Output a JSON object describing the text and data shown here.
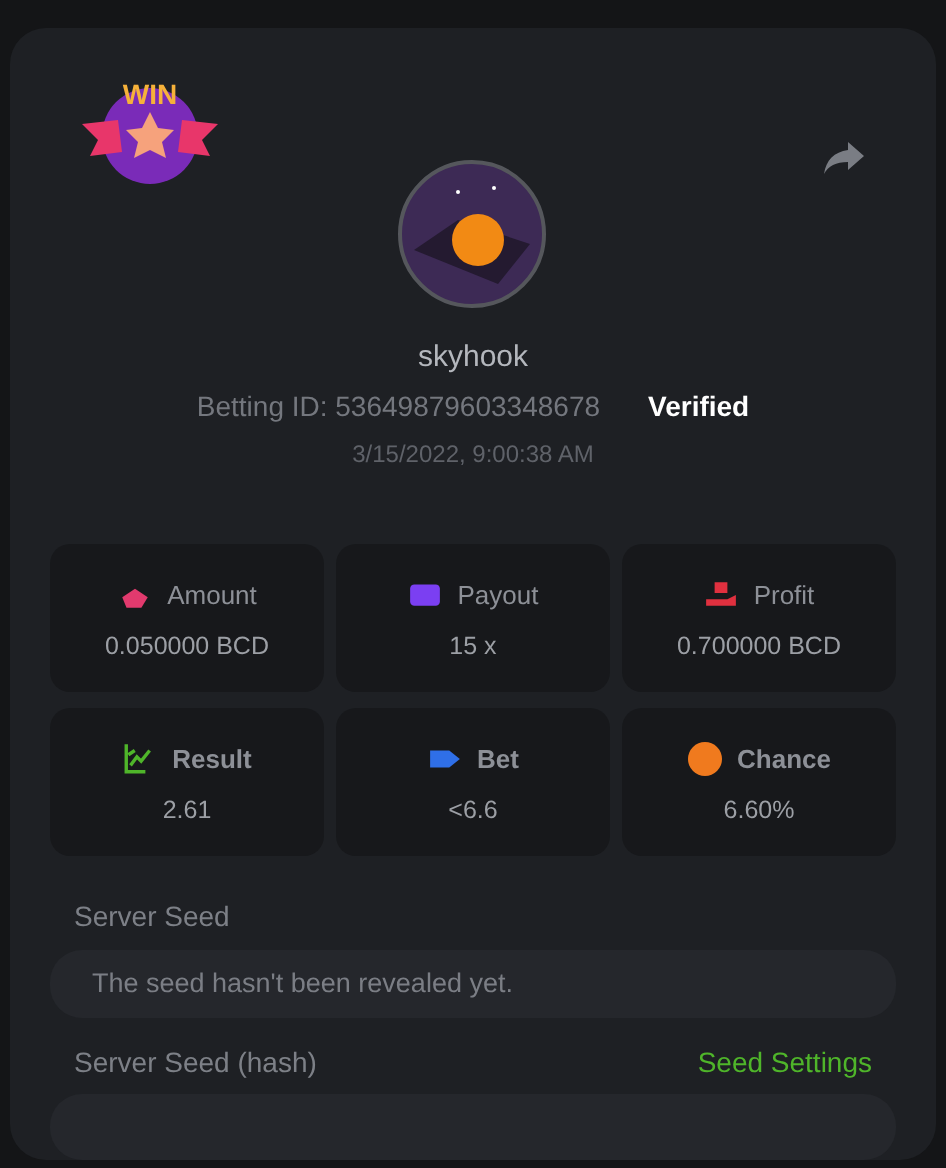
{
  "badge": {
    "text": "WIN"
  },
  "player": {
    "name": "skyhook",
    "betting_id": "Betting ID: 53649879603348678",
    "verified": "Verified",
    "time": "3/15/2022, 9:00:38 AM"
  },
  "stats": [
    {
      "kind": "coins",
      "label": "Amount",
      "value": "0.050000 BCD",
      "color": "#e23a6e",
      "bold": false
    },
    {
      "kind": "card",
      "label": "Payout",
      "value": "15 x",
      "color": "#7b3ff2",
      "bold": false
    },
    {
      "kind": "hand",
      "label": "Profit",
      "value": "0.700000 BCD",
      "color": "#e0303f",
      "bold": false
    },
    {
      "kind": "chart",
      "label": "Result",
      "value": "2.61",
      "color": "#4fb52a",
      "bold": true
    },
    {
      "kind": "ticket",
      "label": "Bet",
      "value": "<6.6",
      "color": "#2f6fe8",
      "bold": true
    },
    {
      "kind": "percent",
      "label": "Chance",
      "value": "6.60%",
      "color": "#f07a1e",
      "bold": true
    }
  ],
  "server_seed": {
    "label": "Server Seed",
    "value": "The seed hasn't been revealed yet."
  },
  "server_seed_hash": {
    "label": "Server Seed (hash)",
    "link": "Seed Settings"
  }
}
